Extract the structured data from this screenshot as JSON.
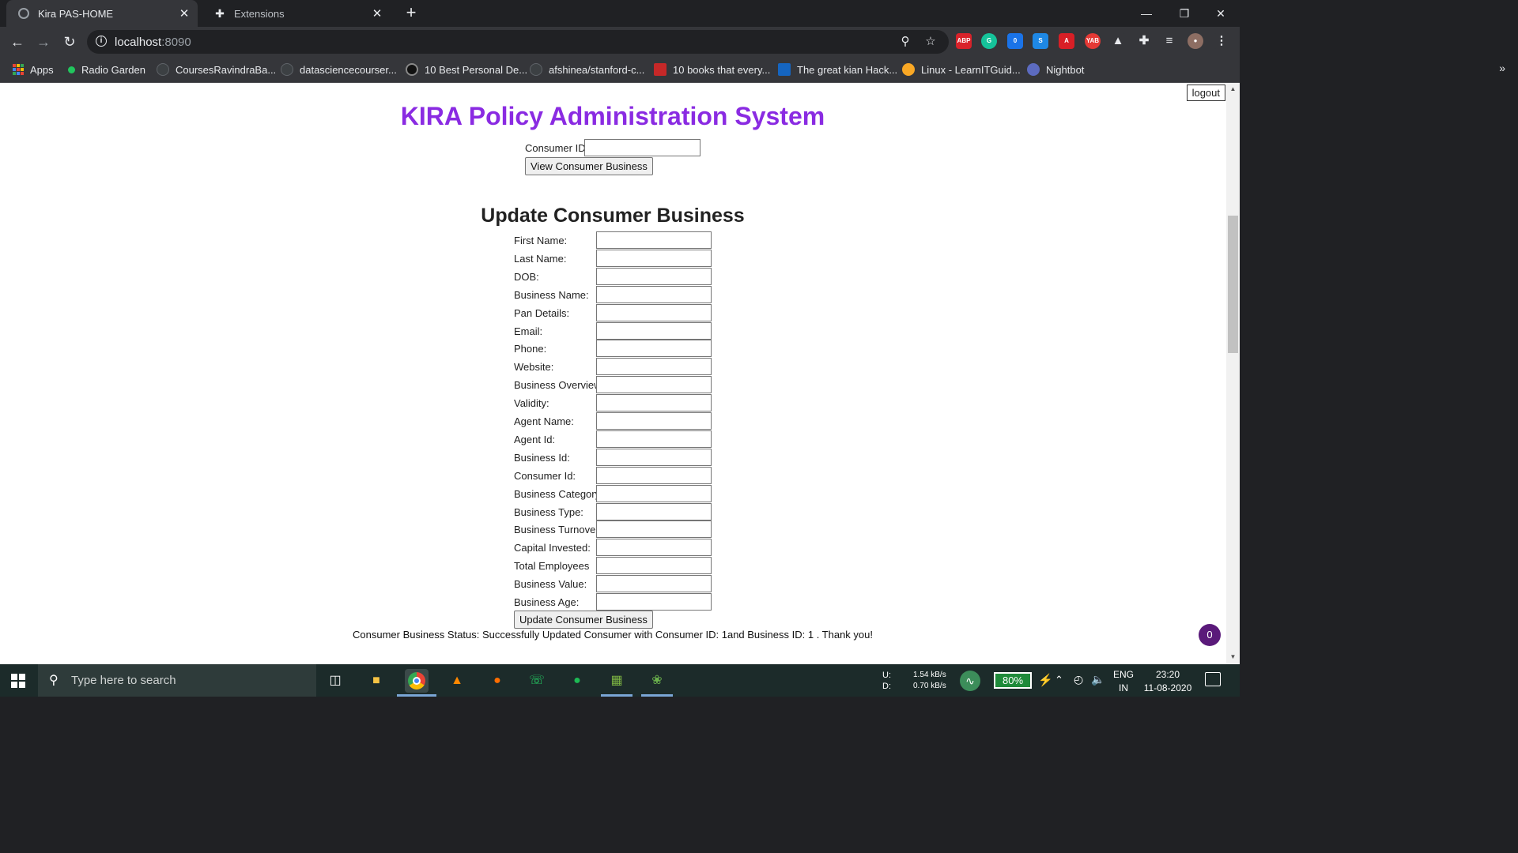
{
  "browser": {
    "tabs": [
      {
        "title": "Kira PAS-HOME",
        "active": true
      },
      {
        "title": "Extensions",
        "active": false
      }
    ],
    "new_tab": "+",
    "address": {
      "host": "localhost",
      "port": ":8090"
    },
    "extensions": [
      {
        "name": "adblock-plus-icon",
        "text": "ABP",
        "color": "#d8222a"
      },
      {
        "name": "grammarly-icon",
        "text": "G",
        "color": "#15c39a"
      },
      {
        "name": "extension-badge-icon",
        "text": "0",
        "color": "#1a73e8"
      },
      {
        "name": "skype-icon",
        "text": "S",
        "color": "#1e88e5"
      },
      {
        "name": "acrobat-icon",
        "text": "A",
        "color": "#d81f26"
      },
      {
        "name": "yab-icon",
        "text": "YAB",
        "color": "#e53935"
      },
      {
        "name": "triangle-icon",
        "text": "▲",
        "color": "#35363a"
      },
      {
        "name": "puzzle-icon",
        "text": "✚",
        "color": "#35363a"
      },
      {
        "name": "reading-list-icon",
        "text": "≡",
        "color": "#35363a"
      },
      {
        "name": "profile-avatar-icon",
        "text": "●",
        "color": "#8d6e63"
      },
      {
        "name": "menu-icon",
        "text": "⋮",
        "color": "#35363a"
      }
    ],
    "bookmarks": [
      {
        "label": "Apps",
        "color": "#ea4335"
      },
      {
        "label": "Radio Garden",
        "color": "#21c55d"
      },
      {
        "label": "CoursesRavindraBa...",
        "color": "#3c4043"
      },
      {
        "label": "datasciencecourser...",
        "color": "#3c4043"
      },
      {
        "label": "10 Best Personal De...",
        "color": "#111111"
      },
      {
        "label": "afshinea/stanford-c...",
        "color": "#3c4043"
      },
      {
        "label": "10 books that every...",
        "color": "#c62828"
      },
      {
        "label": "The great kian Hack...",
        "color": "#1565c0"
      },
      {
        "label": "Linux - LearnITGuid...",
        "color": "#f9a825"
      },
      {
        "label": "Nightbot",
        "color": "#5c6bc0"
      }
    ],
    "bookmarks_more": "»"
  },
  "page": {
    "logout": "logout",
    "title": "KIRA Policy Administration System",
    "consumer_id_label": "Consumer ID:",
    "consumer_id_value": "",
    "view_button": "View Consumer Business",
    "section_title": "Update Consumer Business",
    "form_fields": [
      {
        "label": "First Name:",
        "value": ""
      },
      {
        "label": "Last Name:",
        "value": ""
      },
      {
        "label": "DOB:",
        "value": ""
      },
      {
        "label": "Business Name:",
        "value": ""
      },
      {
        "label": "Pan Details:",
        "value": ""
      },
      {
        "label": "Email:",
        "value": ""
      },
      {
        "label": "Phone:",
        "value": ""
      },
      {
        "label": "Website:",
        "value": ""
      },
      {
        "label": "Business Overview:",
        "value": ""
      },
      {
        "label": "Validity:",
        "value": ""
      },
      {
        "label": "Agent Name:",
        "value": ""
      },
      {
        "label": "Agent Id:",
        "value": ""
      },
      {
        "label": "Business Id:",
        "value": ""
      },
      {
        "label": "Consumer Id:",
        "value": ""
      },
      {
        "label": "Business Category:",
        "value": ""
      },
      {
        "label": "Business Type:",
        "value": ""
      },
      {
        "label": "Business Turnover:",
        "value": ""
      },
      {
        "label": "Capital Invested:",
        "value": ""
      },
      {
        "label": "Total Employees",
        "value": ""
      },
      {
        "label": "Business Value:",
        "value": ""
      },
      {
        "label": "Business Age:",
        "value": ""
      }
    ],
    "update_button": "Update Consumer Business",
    "status_text": "Consumer Business Status: Successfully Updated Consumer with Consumer ID: 1and Business ID: 1 . Thank you!",
    "chat_bubble_count": "0",
    "title_color": "#8a2be2"
  },
  "taskbar": {
    "search_placeholder": "Type here to search",
    "net_upload_label": "U:",
    "net_download_label": "D:",
    "net_upload": "1.54 kB/s",
    "net_download": "0.70 kB/s",
    "battery": "80%",
    "language": "ENG",
    "region": "IN",
    "time": "23:20",
    "date": "11-08-2020"
  }
}
